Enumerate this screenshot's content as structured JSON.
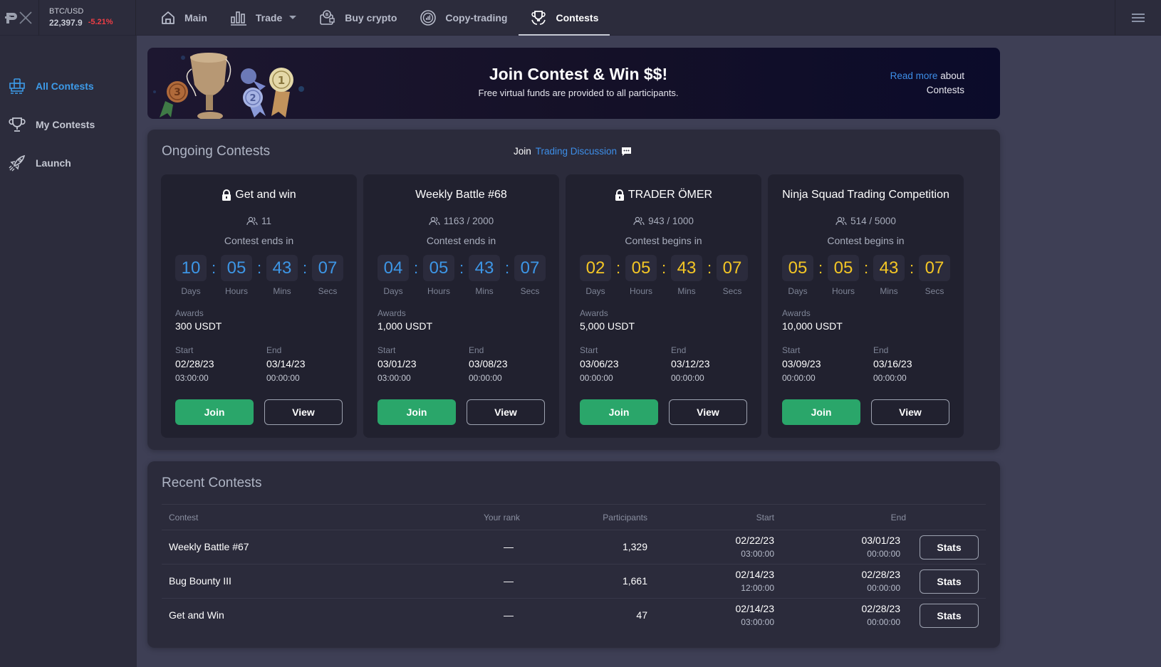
{
  "ticker": {
    "pair": "BTC/USD",
    "price": "22,397.9",
    "change": "-5.21%"
  },
  "nav": {
    "items": [
      {
        "label": "Main",
        "icon": "home-icon"
      },
      {
        "label": "Trade",
        "icon": "bar-chart-icon",
        "dropdown": true
      },
      {
        "label": "Buy crypto",
        "icon": "wallet-coin-icon"
      },
      {
        "label": "Copy-trading",
        "icon": "copy-trading-icon"
      },
      {
        "label": "Contests",
        "icon": "trophy-icon",
        "active": true
      }
    ]
  },
  "sidebar": {
    "items": [
      {
        "label": "All Contests",
        "icon": "contests-icon",
        "active": true
      },
      {
        "label": "My Contests",
        "icon": "trophy-icon"
      },
      {
        "label": "Launch",
        "icon": "rocket-icon"
      }
    ]
  },
  "banner": {
    "title": "Join Contest & Win $$!",
    "subtitle": "Free virtual funds are provided to all participants.",
    "read_more": "Read more",
    "about": " about",
    "contests": "Contests"
  },
  "ongoing": {
    "title": "Ongoing Contests",
    "join_prefix": "Join",
    "discussion_link": "Trading Discussion",
    "unit_labels": [
      "Days",
      "Hours",
      "Mins",
      "Secs"
    ],
    "awards_label": "Awards",
    "start_label": "Start",
    "end_label": "End",
    "join_label": "Join",
    "view_label": "View",
    "cards": [
      {
        "title": "Get and win",
        "locked": true,
        "participants": "11",
        "status": "Contest ends in",
        "timer_color": "blue",
        "timer": [
          "10",
          "05",
          "43",
          "07"
        ],
        "awards": "300 USDT",
        "start_date": "02/28/23",
        "start_time": "03:00:00",
        "end_date": "03/14/23",
        "end_time": "00:00:00"
      },
      {
        "title": "Weekly Battle #68",
        "locked": false,
        "participants": "1163 / 2000",
        "status": "Contest ends in",
        "timer_color": "blue",
        "timer": [
          "04",
          "05",
          "43",
          "07"
        ],
        "awards": "1,000 USDT",
        "start_date": "03/01/23",
        "start_time": "03:00:00",
        "end_date": "03/08/23",
        "end_time": "00:00:00"
      },
      {
        "title": "TRADER ÖMER",
        "locked": true,
        "participants": "943 / 1000",
        "status": "Contest begins in",
        "timer_color": "yellow",
        "timer": [
          "02",
          "05",
          "43",
          "07"
        ],
        "awards": "5,000 USDT",
        "start_date": "03/06/23",
        "start_time": "00:00:00",
        "end_date": "03/12/23",
        "end_time": "00:00:00"
      },
      {
        "title": "Ninja Squad Trading Competition",
        "locked": false,
        "participants": "514 / 5000",
        "status": "Contest begins in",
        "timer_color": "yellow",
        "timer": [
          "05",
          "05",
          "43",
          "07"
        ],
        "awards": "10,000 USDT",
        "start_date": "03/09/23",
        "start_time": "00:00:00",
        "end_date": "03/16/23",
        "end_time": "00:00:00"
      }
    ]
  },
  "recent": {
    "title": "Recent Contests",
    "columns": [
      "Contest",
      "Your rank",
      "Participants",
      "Start",
      "End"
    ],
    "stats_label": "Stats",
    "rows": [
      {
        "contest": "Weekly Battle #67",
        "rank": "—",
        "participants": "1,329",
        "start_date": "02/22/23",
        "start_time": "03:00:00",
        "end_date": "03/01/23",
        "end_time": "00:00:00"
      },
      {
        "contest": "Bug Bounty III",
        "rank": "—",
        "participants": "1,661",
        "start_date": "02/14/23",
        "start_time": "12:00:00",
        "end_date": "02/28/23",
        "end_time": "00:00:00"
      },
      {
        "contest": "Get and Win",
        "rank": "—",
        "participants": "47",
        "start_date": "02/14/23",
        "start_time": "03:00:00",
        "end_date": "02/28/23",
        "end_time": "00:00:00"
      }
    ]
  },
  "colors": {
    "accent_blue": "#3d96e6",
    "timer_yellow": "#f4c625",
    "join_green": "#2aa66a",
    "negative_red": "#ef3e45"
  }
}
